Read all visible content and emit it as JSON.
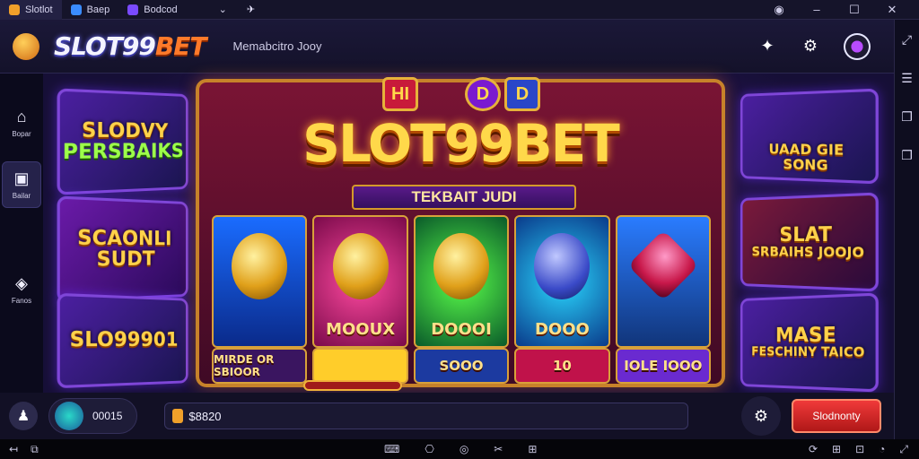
{
  "window": {
    "tabs": [
      {
        "label": "Slotlot",
        "color": "#f0a02a"
      },
      {
        "label": "Baep",
        "color": "#3a8cff"
      },
      {
        "label": "Bodcod",
        "color": "#7a4aff"
      }
    ]
  },
  "header": {
    "logo_main": "SLOT99",
    "logo_accent": "BET",
    "subtitle": "Memabcitro Jooy"
  },
  "sidebar": {
    "items": [
      {
        "icon": "home-icon",
        "label": "Bopar"
      },
      {
        "icon": "square-icon",
        "label": "Bailar"
      },
      {
        "icon": "diamond-icon",
        "label": "Fanos"
      }
    ]
  },
  "left_cards": [
    {
      "line1": "SLODVY",
      "line2": "PERSBAIKS"
    },
    {
      "line1": "SCAONLI",
      "line2": "SUDT"
    },
    {
      "line1": "SLO99901",
      "line2": ""
    }
  ],
  "right_cards": [
    {
      "line1": "UAAD GIE SONG",
      "line2": ""
    },
    {
      "line1": "SLAT",
      "line2": "SRBAIHS JOOJO"
    },
    {
      "line1": "MASE",
      "line2": "FESCHINY TAICO"
    }
  ],
  "machine": {
    "title": "SLOT99BET",
    "ribbon": "TEKBAIT JUDI",
    "badges": [
      "HI",
      "D",
      "D"
    ],
    "reels": [
      {
        "label": ""
      },
      {
        "label": "MOOUX"
      },
      {
        "label": "DOOOI"
      },
      {
        "label": "DOOO"
      },
      {
        "label": ""
      }
    ],
    "bottom_tiles": [
      "MIRDE OR SBIOOR",
      "",
      "SOOO",
      "10",
      "IOLE IOOO"
    ]
  },
  "controls": {
    "balance": "00015",
    "bet_value": "$8820",
    "cta_label": "Slodnonty"
  },
  "colors": {
    "accent": "#ff7a2a",
    "gold": "#ffd84a",
    "machine_border": "#c7822a",
    "cta": "#f03a3a"
  }
}
